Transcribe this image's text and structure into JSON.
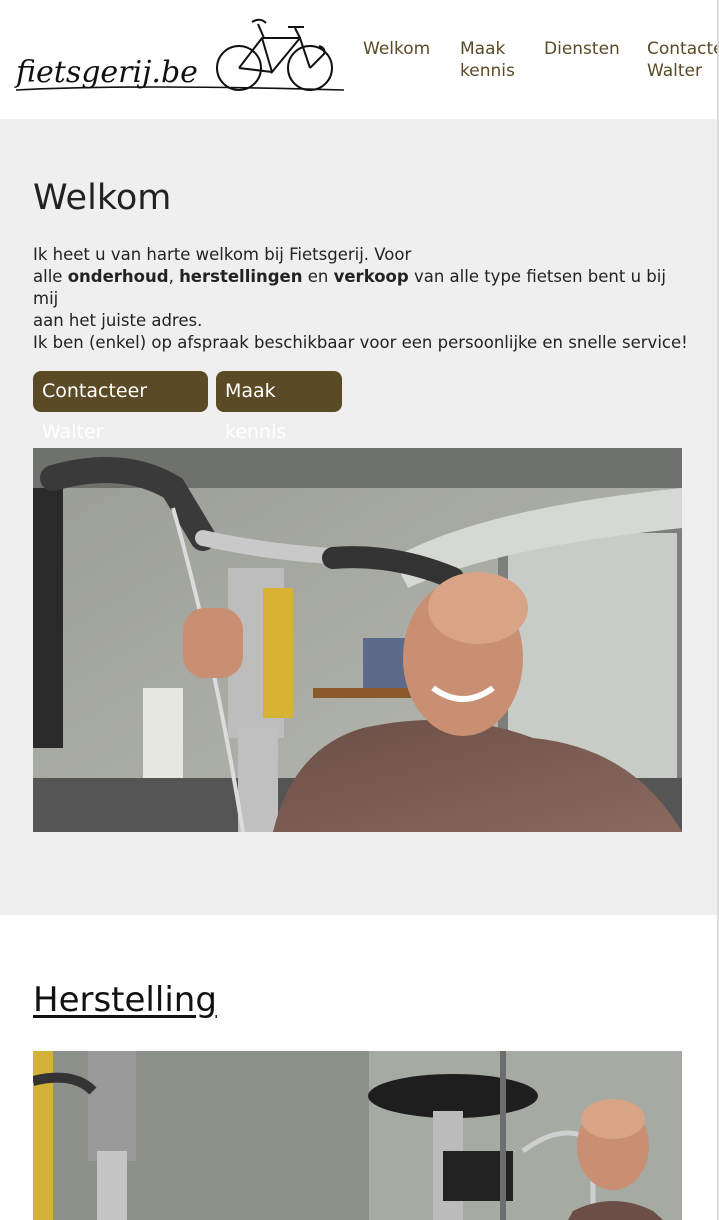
{
  "brand": {
    "logo_text": "fietsgerij.be"
  },
  "nav": {
    "items": [
      {
        "line1": "Welkom",
        "line2": ""
      },
      {
        "line1": "Maak",
        "line2": "kennis"
      },
      {
        "line1": "Diensten",
        "line2": ""
      },
      {
        "line1": "Contacteer",
        "line2": "Walter"
      }
    ]
  },
  "welcome": {
    "title": "Welkom",
    "intro_1": "Ik heet u van harte welkom bij Fietsgerij. Voor",
    "intro_2a": "alle ",
    "intro_bold_1": "onderhoud",
    "intro_2b": ", ",
    "intro_bold_2": "herstellingen",
    "intro_2c": " en ",
    "intro_bold_3": "verkoop",
    "intro_2d": " van alle type fietsen bent u bij mij",
    "intro_3": "aan het juiste adres.",
    "appointment": "Ik ben (enkel) op afspraak beschikbaar voor een persoonlijke en snelle service!",
    "button_contact": "Contacteer Walter",
    "button_meet": "Maak kennis"
  },
  "repair": {
    "title": "Herstelling"
  },
  "colors": {
    "accent": "#5a4a25",
    "section_bg": "#efefef"
  }
}
